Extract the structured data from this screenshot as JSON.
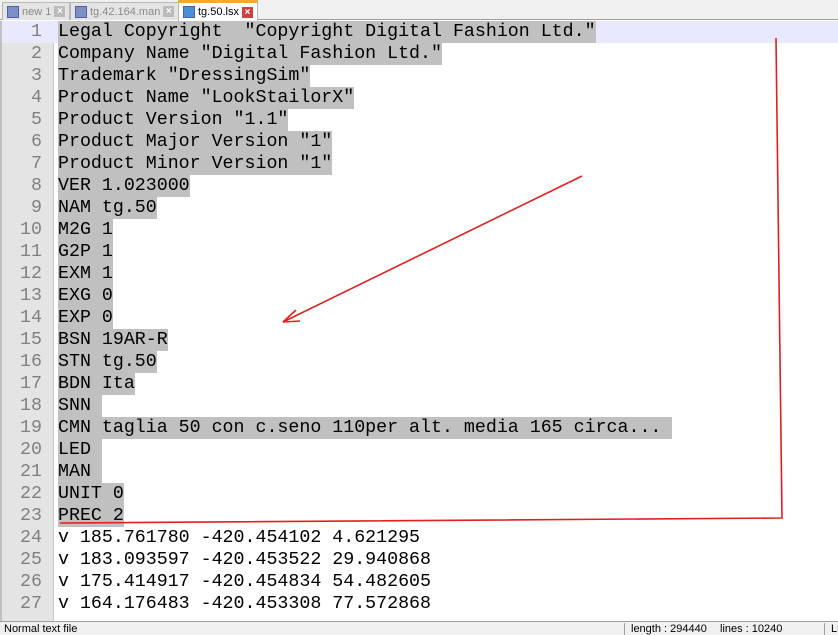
{
  "tabs": [
    {
      "label": "new 1",
      "active": false
    },
    {
      "label": "tg.42.164.man",
      "active": false
    },
    {
      "label": "tg.50.lsx",
      "active": true
    }
  ],
  "lines": [
    "Legal Copyright  \"Copyright Digital Fashion Ltd.\"",
    "Company Name \"Digital Fashion Ltd.\"",
    "Trademark \"DressingSim\"",
    "Product Name \"LookStailorX\"",
    "Product Version \"1.1\"",
    "Product Major Version \"1\"",
    "Product Minor Version \"1\"",
    "VER 1.023000",
    "NAM tg.50",
    "M2G 1",
    "G2P 1",
    "EXM 1",
    "EXG 0",
    "EXP 0",
    "BSN 19AR-R",
    "STN tg.50",
    "BDN Ita",
    "SNN ",
    "CMN taglia 50 con c.seno 110per alt. media 165 circa... ",
    "LED ",
    "MAN ",
    "UNIT 0",
    "PREC 2",
    "v 185.761780 -420.454102 4.621295",
    "v 183.093597 -420.453522 29.940868",
    "v 175.414917 -420.454834 54.482605",
    "v 164.176483 -420.453308 77.572868"
  ],
  "selected_line_count": 23,
  "status": {
    "file_type": "Normal text file",
    "length": "length : 294440",
    "lines": "lines : 10240",
    "extra": "Ln"
  },
  "colors": {
    "annotation": "#e02020",
    "selection": "#c0c0c0",
    "tab_accent": "#f7a630"
  }
}
